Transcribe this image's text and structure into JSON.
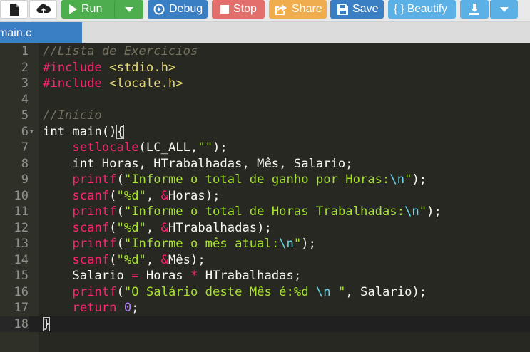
{
  "toolbar": {
    "file_icon": "file-icon",
    "upload_icon": "upload-icon",
    "run_label": "Run",
    "debug_label": "Debug",
    "stop_label": "Stop",
    "share_label": "Share",
    "save_label": "Save",
    "beautify_label": "{ } Beautify",
    "colors": {
      "run": "#4cae4c",
      "debug": "#3a7fc4",
      "stop": "#e36f6d",
      "share": "#f0ad4e",
      "save": "#3a7fc4",
      "beautify": "#5bb0e6"
    }
  },
  "tabs": [
    {
      "label": "main.c",
      "active": true
    }
  ],
  "editor": {
    "theme_background": "#272822",
    "active_line": 18,
    "lines": [
      {
        "n": "1",
        "tokens": [
          {
            "c": "c-comment",
            "t": "//Lista de Exercicios"
          }
        ]
      },
      {
        "n": "2",
        "tokens": [
          {
            "c": "c-pre",
            "t": "#include "
          },
          {
            "c": "c-inc",
            "t": "<stdio.h>"
          }
        ]
      },
      {
        "n": "3",
        "tokens": [
          {
            "c": "c-pre",
            "t": "#include "
          },
          {
            "c": "c-inc",
            "t": "<locale.h>"
          }
        ]
      },
      {
        "n": "4",
        "tokens": []
      },
      {
        "n": "5",
        "tokens": [
          {
            "c": "c-comment",
            "t": "//Inicio"
          }
        ]
      },
      {
        "n": "6",
        "fold": true,
        "tokens": [
          {
            "c": "c-type",
            "t": "int"
          },
          {
            "c": "c-plain",
            "t": " main()"
          },
          {
            "c": "c-plain brace-box",
            "t": "{"
          }
        ]
      },
      {
        "n": "7",
        "tokens": [
          {
            "c": "c-plain",
            "t": "    "
          },
          {
            "c": "c-fn",
            "t": "setlocale"
          },
          {
            "c": "c-plain",
            "t": "(LC_ALL,"
          },
          {
            "c": "c-str",
            "t": "\"\""
          },
          {
            "c": "c-plain",
            "t": ");"
          }
        ]
      },
      {
        "n": "8",
        "tokens": [
          {
            "c": "c-plain",
            "t": "    "
          },
          {
            "c": "c-type",
            "t": "int"
          },
          {
            "c": "c-plain",
            "t": " Horas, HTrabalhadas, Mês, Salario;"
          }
        ]
      },
      {
        "n": "9",
        "tokens": [
          {
            "c": "c-plain",
            "t": "    "
          },
          {
            "c": "c-fn",
            "t": "printf"
          },
          {
            "c": "c-plain",
            "t": "("
          },
          {
            "c": "c-str",
            "t": "\"Informe o total de ganho por Horas:"
          },
          {
            "c": "c-esc",
            "t": "\\n"
          },
          {
            "c": "c-str",
            "t": "\""
          },
          {
            "c": "c-plain",
            "t": ");"
          }
        ]
      },
      {
        "n": "10",
        "tokens": [
          {
            "c": "c-plain",
            "t": "    "
          },
          {
            "c": "c-fn",
            "t": "scanf"
          },
          {
            "c": "c-plain",
            "t": "("
          },
          {
            "c": "c-str",
            "t": "\"%d\""
          },
          {
            "c": "c-plain",
            "t": ", "
          },
          {
            "c": "c-op",
            "t": "&"
          },
          {
            "c": "c-plain",
            "t": "Horas);"
          }
        ]
      },
      {
        "n": "11",
        "tokens": [
          {
            "c": "c-plain",
            "t": "    "
          },
          {
            "c": "c-fn",
            "t": "printf"
          },
          {
            "c": "c-plain",
            "t": "("
          },
          {
            "c": "c-str",
            "t": "\"Informe o total de Horas Trabalhadas:"
          },
          {
            "c": "c-esc",
            "t": "\\n"
          },
          {
            "c": "c-str",
            "t": "\""
          },
          {
            "c": "c-plain",
            "t": ");"
          }
        ]
      },
      {
        "n": "12",
        "tokens": [
          {
            "c": "c-plain",
            "t": "    "
          },
          {
            "c": "c-fn",
            "t": "scanf"
          },
          {
            "c": "c-plain",
            "t": "("
          },
          {
            "c": "c-str",
            "t": "\"%d\""
          },
          {
            "c": "c-plain",
            "t": ", "
          },
          {
            "c": "c-op",
            "t": "&"
          },
          {
            "c": "c-plain",
            "t": "HTrabalhadas);"
          }
        ]
      },
      {
        "n": "13",
        "tokens": [
          {
            "c": "c-plain",
            "t": "    "
          },
          {
            "c": "c-fn",
            "t": "printf"
          },
          {
            "c": "c-plain",
            "t": "("
          },
          {
            "c": "c-str",
            "t": "\"Informe o mês atual:"
          },
          {
            "c": "c-esc",
            "t": "\\n"
          },
          {
            "c": "c-str",
            "t": "\""
          },
          {
            "c": "c-plain",
            "t": ");"
          }
        ]
      },
      {
        "n": "14",
        "tokens": [
          {
            "c": "c-plain",
            "t": "    "
          },
          {
            "c": "c-fn",
            "t": "scanf"
          },
          {
            "c": "c-plain",
            "t": "("
          },
          {
            "c": "c-str",
            "t": "\"%d\""
          },
          {
            "c": "c-plain",
            "t": ", "
          },
          {
            "c": "c-op",
            "t": "&"
          },
          {
            "c": "c-plain",
            "t": "Mês);"
          }
        ]
      },
      {
        "n": "15",
        "tokens": [
          {
            "c": "c-plain",
            "t": "    Salario "
          },
          {
            "c": "c-op",
            "t": "="
          },
          {
            "c": "c-plain",
            "t": " Horas "
          },
          {
            "c": "c-op",
            "t": "*"
          },
          {
            "c": "c-plain",
            "t": " HTrabalhadas;"
          }
        ]
      },
      {
        "n": "16",
        "tokens": [
          {
            "c": "c-plain",
            "t": "    "
          },
          {
            "c": "c-fn",
            "t": "printf"
          },
          {
            "c": "c-plain",
            "t": "("
          },
          {
            "c": "c-str",
            "t": "\"O Salário deste Mês é:%d "
          },
          {
            "c": "c-esc",
            "t": "\\n"
          },
          {
            "c": "c-str",
            "t": " \""
          },
          {
            "c": "c-plain",
            "t": ", Salario);"
          }
        ]
      },
      {
        "n": "17",
        "tokens": [
          {
            "c": "c-plain",
            "t": "    "
          },
          {
            "c": "c-kw",
            "t": "return"
          },
          {
            "c": "c-plain",
            "t": " "
          },
          {
            "c": "c-num",
            "t": "0"
          },
          {
            "c": "c-plain",
            "t": ";"
          }
        ]
      },
      {
        "n": "18",
        "tokens": [
          {
            "c": "c-plain cursor-brace",
            "t": "}"
          }
        ]
      }
    ]
  }
}
